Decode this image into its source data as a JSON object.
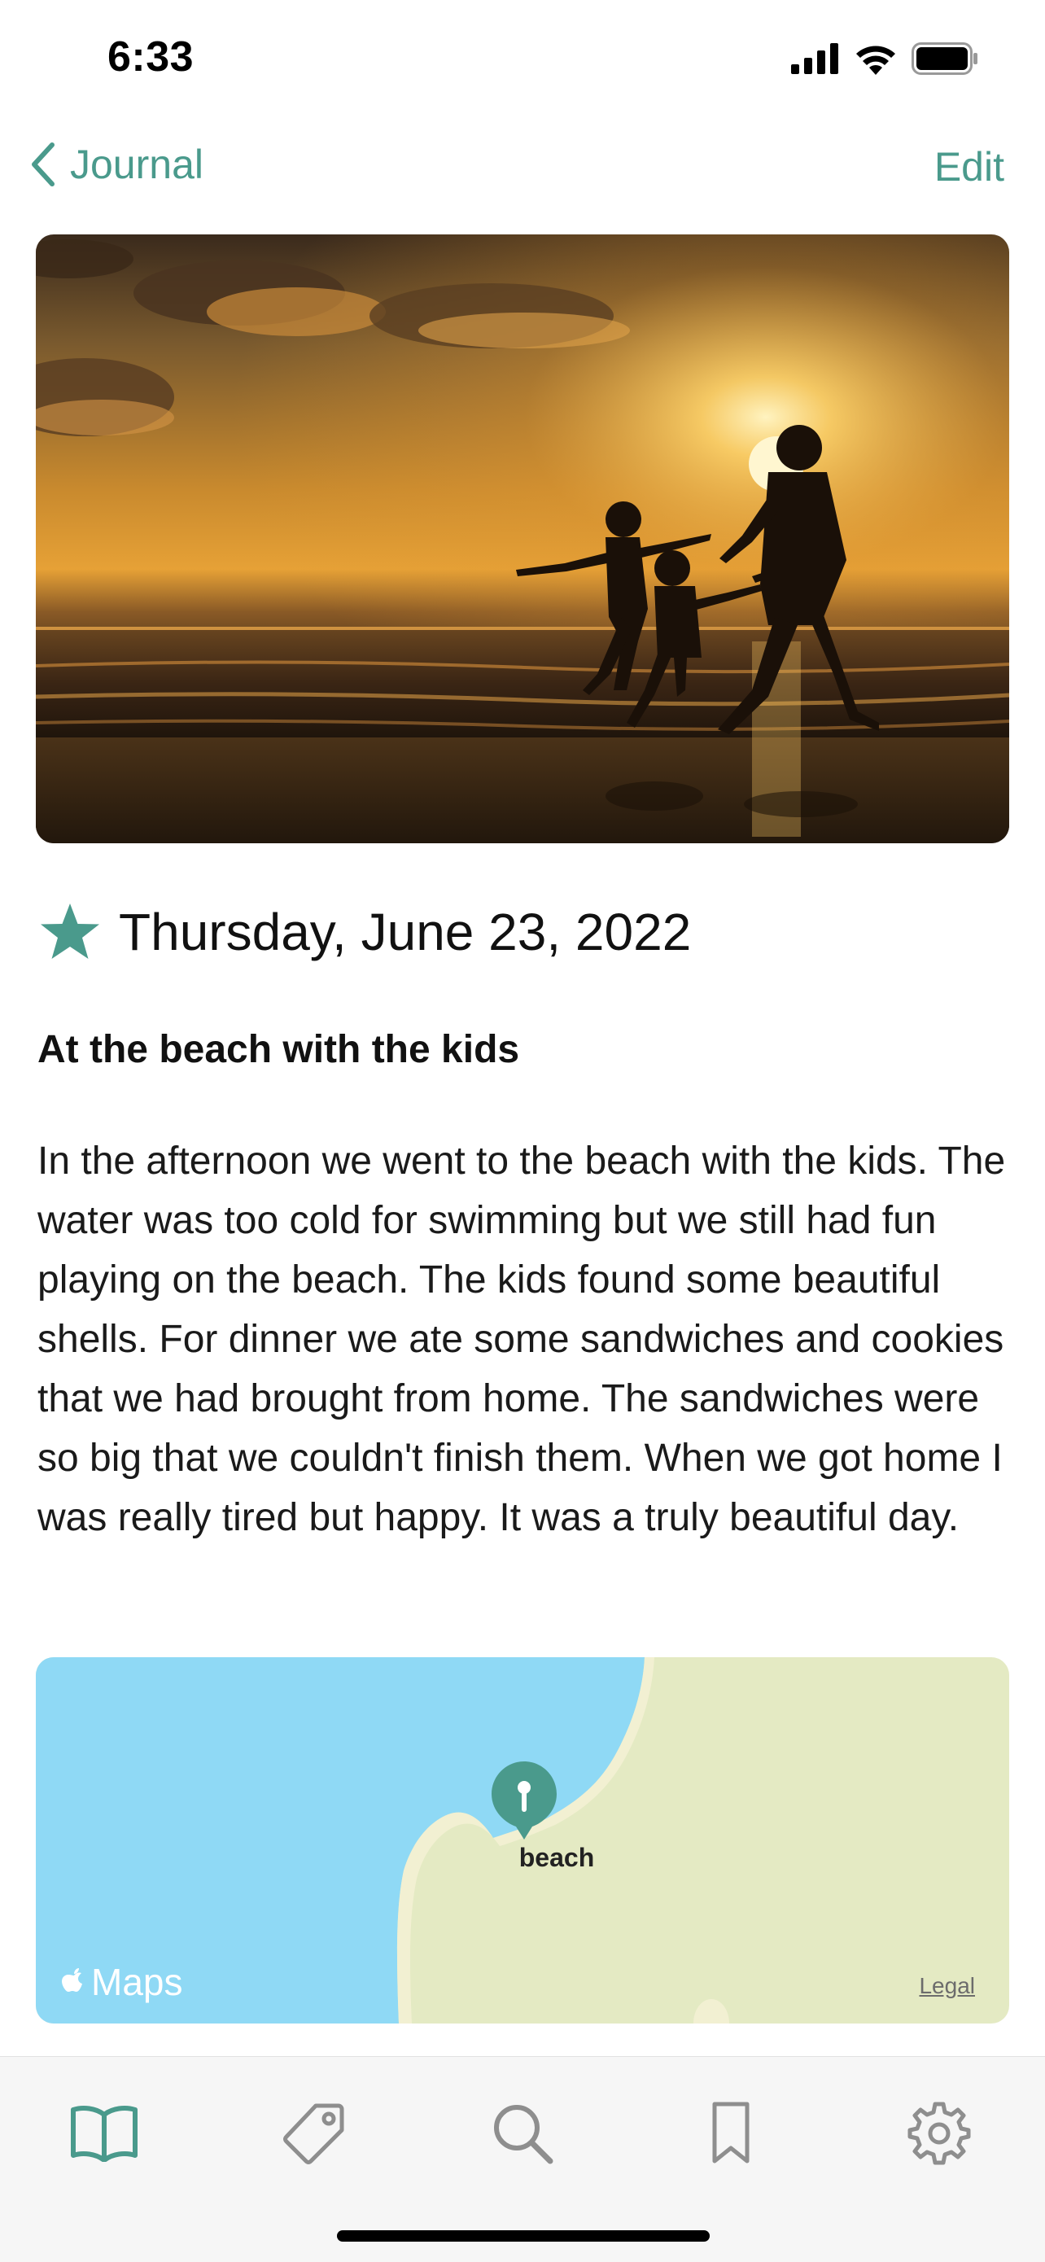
{
  "status_bar": {
    "time": "6:33"
  },
  "nav": {
    "back_label": "Journal",
    "edit_label": "Edit"
  },
  "entry": {
    "favorite": true,
    "date": "Thursday, June 23, 2022",
    "title": "At the beach with the kids",
    "body": "In the afternoon we went to the beach with the kids. The water was too cold for swimming but we still had fun playing on the beach. The kids found some beautiful shells. For dinner we ate some sandwiches and cookies that we had brought from home. The sandwiches were so big that we couldn't finish them. When we got home I was really tired but happy. It was a truly beautiful day."
  },
  "map": {
    "pin_label": "beach",
    "logo_text": "Maps",
    "legal_label": "Legal"
  },
  "tabs": [
    {
      "icon": "book-icon",
      "active": true
    },
    {
      "icon": "tag-icon",
      "active": false
    },
    {
      "icon": "search-icon",
      "active": false
    },
    {
      "icon": "bookmark-icon",
      "active": false
    },
    {
      "icon": "gear-icon",
      "active": false
    }
  ],
  "colors": {
    "accent": "#4a9a8c",
    "inactive_icon": "#8e8e8e",
    "water": "#8fd9f5",
    "land": "#e4eac3"
  }
}
